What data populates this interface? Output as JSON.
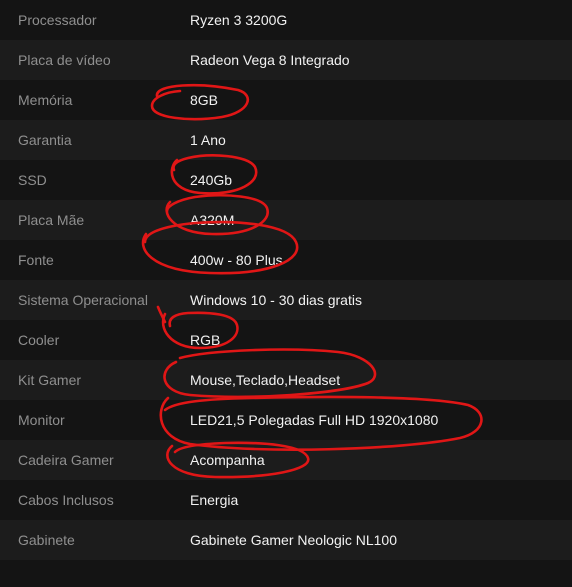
{
  "specs": [
    {
      "label": "Processador",
      "value": "Ryzen 3 3200G"
    },
    {
      "label": "Placa de vídeo",
      "value": "Radeon Vega 8 Integrado"
    },
    {
      "label": "Memória",
      "value": "8GB"
    },
    {
      "label": "Garantia",
      "value": "1 Ano"
    },
    {
      "label": "SSD",
      "value": "240Gb"
    },
    {
      "label": "Placa Mãe",
      "value": "A320M"
    },
    {
      "label": "Fonte",
      "value": "400w - 80 Plus"
    },
    {
      "label": "Sistema Operacional",
      "value": "Windows 10 - 30 dias gratis"
    },
    {
      "label": "Cooler",
      "value": "RGB"
    },
    {
      "label": "Kit Gamer",
      "value": "Mouse,Teclado,Headset"
    },
    {
      "label": "Monitor",
      "value": "LED21,5 Polegadas Full HD 1920x1080"
    },
    {
      "label": "Cadeira Gamer",
      "value": "Acompanha"
    },
    {
      "label": "Cabos Inclusos",
      "value": "Energia"
    },
    {
      "label": "Gabinete",
      "value": "Gabinete Gamer Neologic NL100"
    }
  ],
  "colors": {
    "background": "#141414",
    "row_alt": "#1c1c1c",
    "label_text": "#8f8f8f",
    "value_text": "#f2f2f2",
    "annotation_red": "#e01616"
  }
}
